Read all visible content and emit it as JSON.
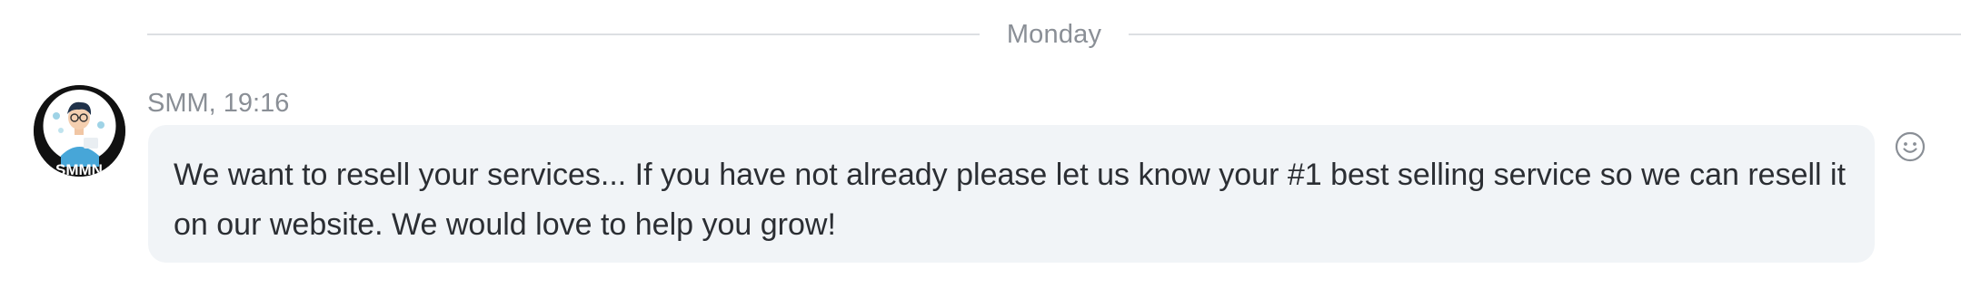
{
  "divider": {
    "label": "Monday"
  },
  "message": {
    "sender": "SMM",
    "time": "19:16",
    "header": "SMM, 19:16",
    "text": "We want to resell your services... If you have not already please let us know your #1 best selling service so we can resell it on our website. We would love to help you grow!",
    "avatar_text": "SMMN"
  },
  "icons": {
    "reaction": "smiley-face-icon"
  },
  "colors": {
    "bubble_background": "#f1f4f7",
    "meta_text": "#8a8f96",
    "message_text": "#2b2e33",
    "divider_line": "#dcdfe3"
  }
}
